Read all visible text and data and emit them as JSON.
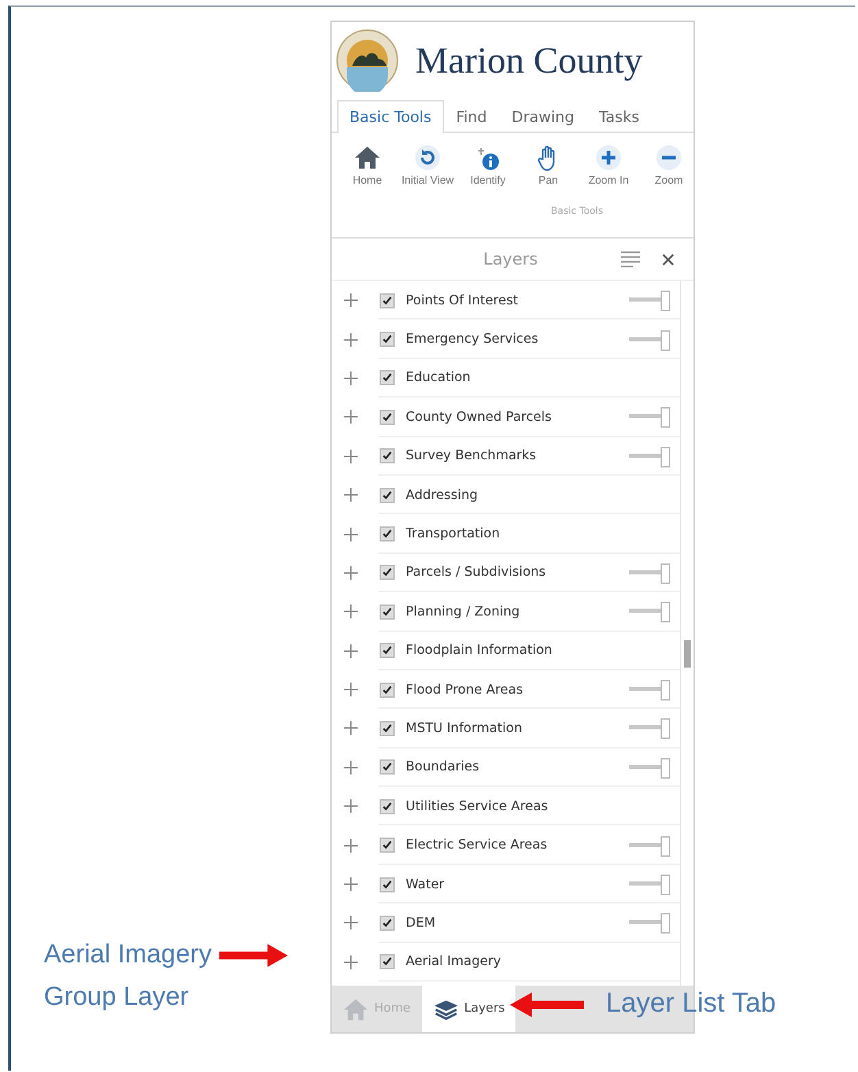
{
  "header": {
    "title": "Marion County"
  },
  "tabs": [
    {
      "label": "Basic Tools",
      "selected": true
    },
    {
      "label": "Find",
      "selected": false
    },
    {
      "label": "Drawing",
      "selected": false
    },
    {
      "label": "Tasks",
      "selected": false
    }
  ],
  "toolbar": {
    "tools": [
      {
        "kind": "home",
        "label": "Home"
      },
      {
        "kind": "initial-view",
        "label": "Initial View"
      },
      {
        "kind": "identify",
        "label": "Identify"
      },
      {
        "kind": "pan",
        "label": "Pan"
      },
      {
        "kind": "zoom-in",
        "label": "Zoom In"
      },
      {
        "kind": "zoom-out",
        "label": "Zoom"
      }
    ],
    "group_label": "Basic Tools"
  },
  "layers_panel": {
    "title": "Layers",
    "layers": [
      {
        "name": "Points Of Interest",
        "checked": true,
        "level": 1
      },
      {
        "name": "Emergency Services",
        "checked": true,
        "level": 1
      },
      {
        "name": "Education",
        "checked": true
      },
      {
        "name": "County Owned Parcels",
        "checked": true,
        "level": 1
      },
      {
        "name": "Survey Benchmarks",
        "checked": true,
        "level": 1
      },
      {
        "name": "Addressing",
        "checked": true
      },
      {
        "name": "Transportation",
        "checked": true
      },
      {
        "name": "Parcels / Subdivisions",
        "checked": true,
        "level": 1
      },
      {
        "name": "Planning / Zoning",
        "checked": true,
        "level": 1
      },
      {
        "name": "Floodplain Information",
        "checked": true
      },
      {
        "name": "Flood Prone Areas",
        "checked": true,
        "level": 1
      },
      {
        "name": "MSTU Information",
        "checked": true,
        "level": 1
      },
      {
        "name": "Boundaries",
        "checked": true,
        "level": 1
      },
      {
        "name": "Utilities Service Areas",
        "checked": true
      },
      {
        "name": "Electric Service Areas",
        "checked": true,
        "level": 1
      },
      {
        "name": "Water",
        "checked": true,
        "level": 1
      },
      {
        "name": "DEM",
        "checked": true,
        "level": 1
      },
      {
        "name": "Aerial Imagery",
        "checked": true
      }
    ]
  },
  "bottom_tabs": [
    {
      "kind": "home",
      "label": "Home",
      "selected": false
    },
    {
      "kind": "layers",
      "label": "Layers",
      "selected": true
    }
  ],
  "annotations": {
    "left": [
      "Aerial Imagery",
      "Group Layer"
    ],
    "right": "Layer List Tab"
  }
}
